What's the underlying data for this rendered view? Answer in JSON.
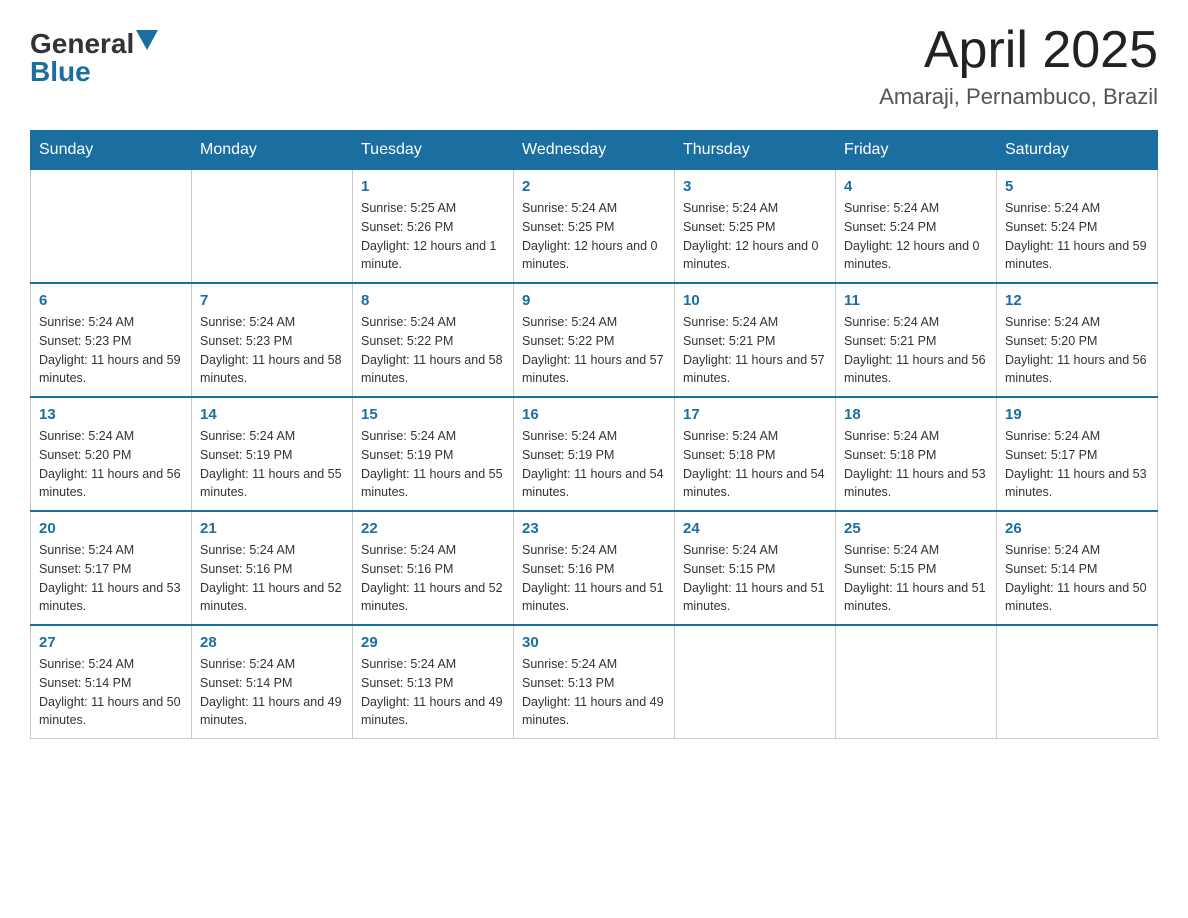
{
  "header": {
    "logo_general": "General",
    "logo_blue": "Blue",
    "title": "April 2025",
    "subtitle": "Amaraji, Pernambuco, Brazil"
  },
  "weekdays": [
    "Sunday",
    "Monday",
    "Tuesday",
    "Wednesday",
    "Thursday",
    "Friday",
    "Saturday"
  ],
  "weeks": [
    [
      {
        "day": "",
        "sunrise": "",
        "sunset": "",
        "daylight": ""
      },
      {
        "day": "",
        "sunrise": "",
        "sunset": "",
        "daylight": ""
      },
      {
        "day": "1",
        "sunrise": "Sunrise: 5:25 AM",
        "sunset": "Sunset: 5:26 PM",
        "daylight": "Daylight: 12 hours and 1 minute."
      },
      {
        "day": "2",
        "sunrise": "Sunrise: 5:24 AM",
        "sunset": "Sunset: 5:25 PM",
        "daylight": "Daylight: 12 hours and 0 minutes."
      },
      {
        "day": "3",
        "sunrise": "Sunrise: 5:24 AM",
        "sunset": "Sunset: 5:25 PM",
        "daylight": "Daylight: 12 hours and 0 minutes."
      },
      {
        "day": "4",
        "sunrise": "Sunrise: 5:24 AM",
        "sunset": "Sunset: 5:24 PM",
        "daylight": "Daylight: 12 hours and 0 minutes."
      },
      {
        "day": "5",
        "sunrise": "Sunrise: 5:24 AM",
        "sunset": "Sunset: 5:24 PM",
        "daylight": "Daylight: 11 hours and 59 minutes."
      }
    ],
    [
      {
        "day": "6",
        "sunrise": "Sunrise: 5:24 AM",
        "sunset": "Sunset: 5:23 PM",
        "daylight": "Daylight: 11 hours and 59 minutes."
      },
      {
        "day": "7",
        "sunrise": "Sunrise: 5:24 AM",
        "sunset": "Sunset: 5:23 PM",
        "daylight": "Daylight: 11 hours and 58 minutes."
      },
      {
        "day": "8",
        "sunrise": "Sunrise: 5:24 AM",
        "sunset": "Sunset: 5:22 PM",
        "daylight": "Daylight: 11 hours and 58 minutes."
      },
      {
        "day": "9",
        "sunrise": "Sunrise: 5:24 AM",
        "sunset": "Sunset: 5:22 PM",
        "daylight": "Daylight: 11 hours and 57 minutes."
      },
      {
        "day": "10",
        "sunrise": "Sunrise: 5:24 AM",
        "sunset": "Sunset: 5:21 PM",
        "daylight": "Daylight: 11 hours and 57 minutes."
      },
      {
        "day": "11",
        "sunrise": "Sunrise: 5:24 AM",
        "sunset": "Sunset: 5:21 PM",
        "daylight": "Daylight: 11 hours and 56 minutes."
      },
      {
        "day": "12",
        "sunrise": "Sunrise: 5:24 AM",
        "sunset": "Sunset: 5:20 PM",
        "daylight": "Daylight: 11 hours and 56 minutes."
      }
    ],
    [
      {
        "day": "13",
        "sunrise": "Sunrise: 5:24 AM",
        "sunset": "Sunset: 5:20 PM",
        "daylight": "Daylight: 11 hours and 56 minutes."
      },
      {
        "day": "14",
        "sunrise": "Sunrise: 5:24 AM",
        "sunset": "Sunset: 5:19 PM",
        "daylight": "Daylight: 11 hours and 55 minutes."
      },
      {
        "day": "15",
        "sunrise": "Sunrise: 5:24 AM",
        "sunset": "Sunset: 5:19 PM",
        "daylight": "Daylight: 11 hours and 55 minutes."
      },
      {
        "day": "16",
        "sunrise": "Sunrise: 5:24 AM",
        "sunset": "Sunset: 5:19 PM",
        "daylight": "Daylight: 11 hours and 54 minutes."
      },
      {
        "day": "17",
        "sunrise": "Sunrise: 5:24 AM",
        "sunset": "Sunset: 5:18 PM",
        "daylight": "Daylight: 11 hours and 54 minutes."
      },
      {
        "day": "18",
        "sunrise": "Sunrise: 5:24 AM",
        "sunset": "Sunset: 5:18 PM",
        "daylight": "Daylight: 11 hours and 53 minutes."
      },
      {
        "day": "19",
        "sunrise": "Sunrise: 5:24 AM",
        "sunset": "Sunset: 5:17 PM",
        "daylight": "Daylight: 11 hours and 53 minutes."
      }
    ],
    [
      {
        "day": "20",
        "sunrise": "Sunrise: 5:24 AM",
        "sunset": "Sunset: 5:17 PM",
        "daylight": "Daylight: 11 hours and 53 minutes."
      },
      {
        "day": "21",
        "sunrise": "Sunrise: 5:24 AM",
        "sunset": "Sunset: 5:16 PM",
        "daylight": "Daylight: 11 hours and 52 minutes."
      },
      {
        "day": "22",
        "sunrise": "Sunrise: 5:24 AM",
        "sunset": "Sunset: 5:16 PM",
        "daylight": "Daylight: 11 hours and 52 minutes."
      },
      {
        "day": "23",
        "sunrise": "Sunrise: 5:24 AM",
        "sunset": "Sunset: 5:16 PM",
        "daylight": "Daylight: 11 hours and 51 minutes."
      },
      {
        "day": "24",
        "sunrise": "Sunrise: 5:24 AM",
        "sunset": "Sunset: 5:15 PM",
        "daylight": "Daylight: 11 hours and 51 minutes."
      },
      {
        "day": "25",
        "sunrise": "Sunrise: 5:24 AM",
        "sunset": "Sunset: 5:15 PM",
        "daylight": "Daylight: 11 hours and 51 minutes."
      },
      {
        "day": "26",
        "sunrise": "Sunrise: 5:24 AM",
        "sunset": "Sunset: 5:14 PM",
        "daylight": "Daylight: 11 hours and 50 minutes."
      }
    ],
    [
      {
        "day": "27",
        "sunrise": "Sunrise: 5:24 AM",
        "sunset": "Sunset: 5:14 PM",
        "daylight": "Daylight: 11 hours and 50 minutes."
      },
      {
        "day": "28",
        "sunrise": "Sunrise: 5:24 AM",
        "sunset": "Sunset: 5:14 PM",
        "daylight": "Daylight: 11 hours and 49 minutes."
      },
      {
        "day": "29",
        "sunrise": "Sunrise: 5:24 AM",
        "sunset": "Sunset: 5:13 PM",
        "daylight": "Daylight: 11 hours and 49 minutes."
      },
      {
        "day": "30",
        "sunrise": "Sunrise: 5:24 AM",
        "sunset": "Sunset: 5:13 PM",
        "daylight": "Daylight: 11 hours and 49 minutes."
      },
      {
        "day": "",
        "sunrise": "",
        "sunset": "",
        "daylight": ""
      },
      {
        "day": "",
        "sunrise": "",
        "sunset": "",
        "daylight": ""
      },
      {
        "day": "",
        "sunrise": "",
        "sunset": "",
        "daylight": ""
      }
    ]
  ]
}
